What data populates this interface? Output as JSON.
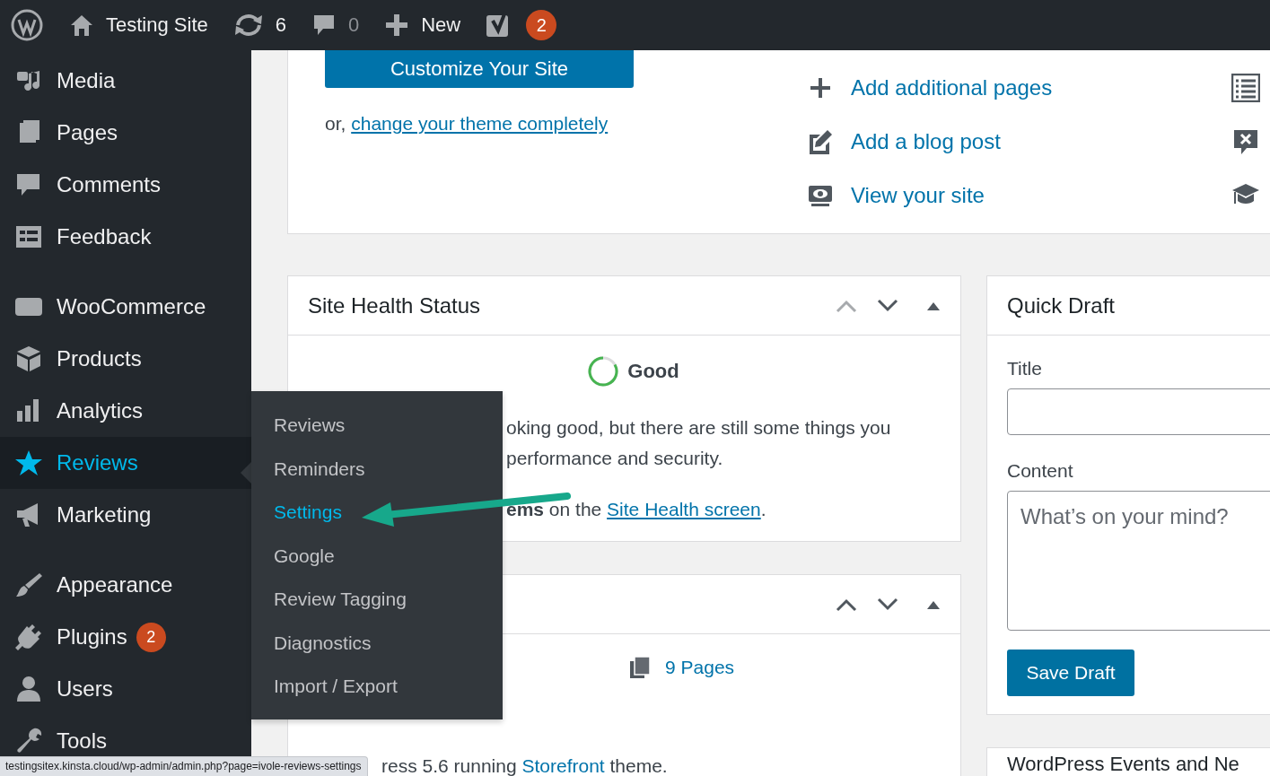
{
  "admin_bar": {
    "site_name": "Testing Site",
    "updates": "6",
    "comments": "0",
    "new_label": "New",
    "seo_badge": "2"
  },
  "sidebar": {
    "groups": [
      [
        {
          "label": "Media",
          "selected": false
        },
        {
          "label": "Pages",
          "selected": false
        },
        {
          "label": "Comments",
          "selected": false
        },
        {
          "label": "Feedback",
          "selected": false
        }
      ],
      [
        {
          "label": "WooCommerce",
          "selected": false
        },
        {
          "label": "Products",
          "selected": false
        },
        {
          "label": "Analytics",
          "selected": false
        },
        {
          "label": "Reviews",
          "selected": true
        },
        {
          "label": "Marketing",
          "selected": false
        }
      ],
      [
        {
          "label": "Appearance",
          "selected": false
        },
        {
          "label": "Plugins",
          "selected": false,
          "badge": "2"
        },
        {
          "label": "Users",
          "selected": false
        },
        {
          "label": "Tools",
          "selected": false
        }
      ]
    ]
  },
  "flyout": {
    "items": [
      {
        "label": "Reviews",
        "selected": false
      },
      {
        "label": "Reminders",
        "selected": false
      },
      {
        "label": "Settings",
        "selected": true
      },
      {
        "label": "Google",
        "selected": false
      },
      {
        "label": "Review Tagging",
        "selected": false
      },
      {
        "label": "Diagnostics",
        "selected": false
      },
      {
        "label": "Import / Export",
        "selected": false
      }
    ]
  },
  "welcome": {
    "button": "Customize Your Site",
    "alt_prefix": "or,",
    "alt_link": "change your theme completely",
    "actions": [
      "Add additional pages",
      "Add a blog post",
      "View your site"
    ]
  },
  "site_health": {
    "title": "Site Health Status",
    "status": "Good",
    "message_lines": [
      "oking good, but there are still some things you",
      "performance and security."
    ],
    "footer_prefix": "**ems** on the",
    "footer_link": "Site Health screen",
    "footer_suffix": "."
  },
  "at_a_glance": {
    "pages": "9 Pages",
    "version_prefix": "ress 5.6 running",
    "theme_link": "Storefront",
    "version_suffix": "theme."
  },
  "quick_draft": {
    "title": "Quick Draft",
    "title_label": "Title",
    "content_label": "Content",
    "content_placeholder": "What’s on your mind?",
    "save_button": "Save Draft"
  },
  "events": {
    "title": "WordPress Events and Ne"
  },
  "status_url": "testingsitex.kinsta.cloud/wp-admin/admin.php?page=ivole-reviews-settings"
}
